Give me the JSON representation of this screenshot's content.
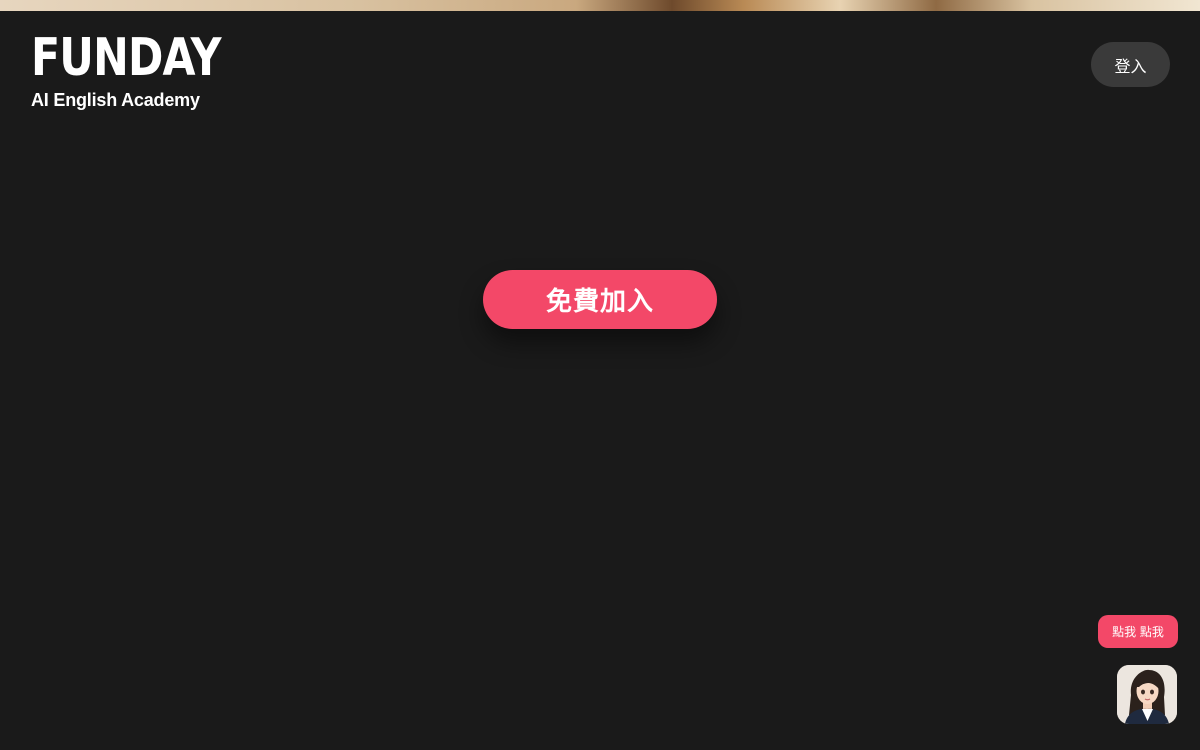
{
  "header": {
    "logo_word": "FUNDAY",
    "logo_tagline": "AI English Academy",
    "login_label": "登入"
  },
  "hero": {
    "join_label": "免費加入"
  },
  "assistant": {
    "bubble_label": "點我 點我",
    "avatar_icon": "assistant-avatar-icon"
  },
  "colors": {
    "background": "#1a1a1a",
    "accent": "#f34868",
    "login_bg": "#3a3a3a"
  }
}
